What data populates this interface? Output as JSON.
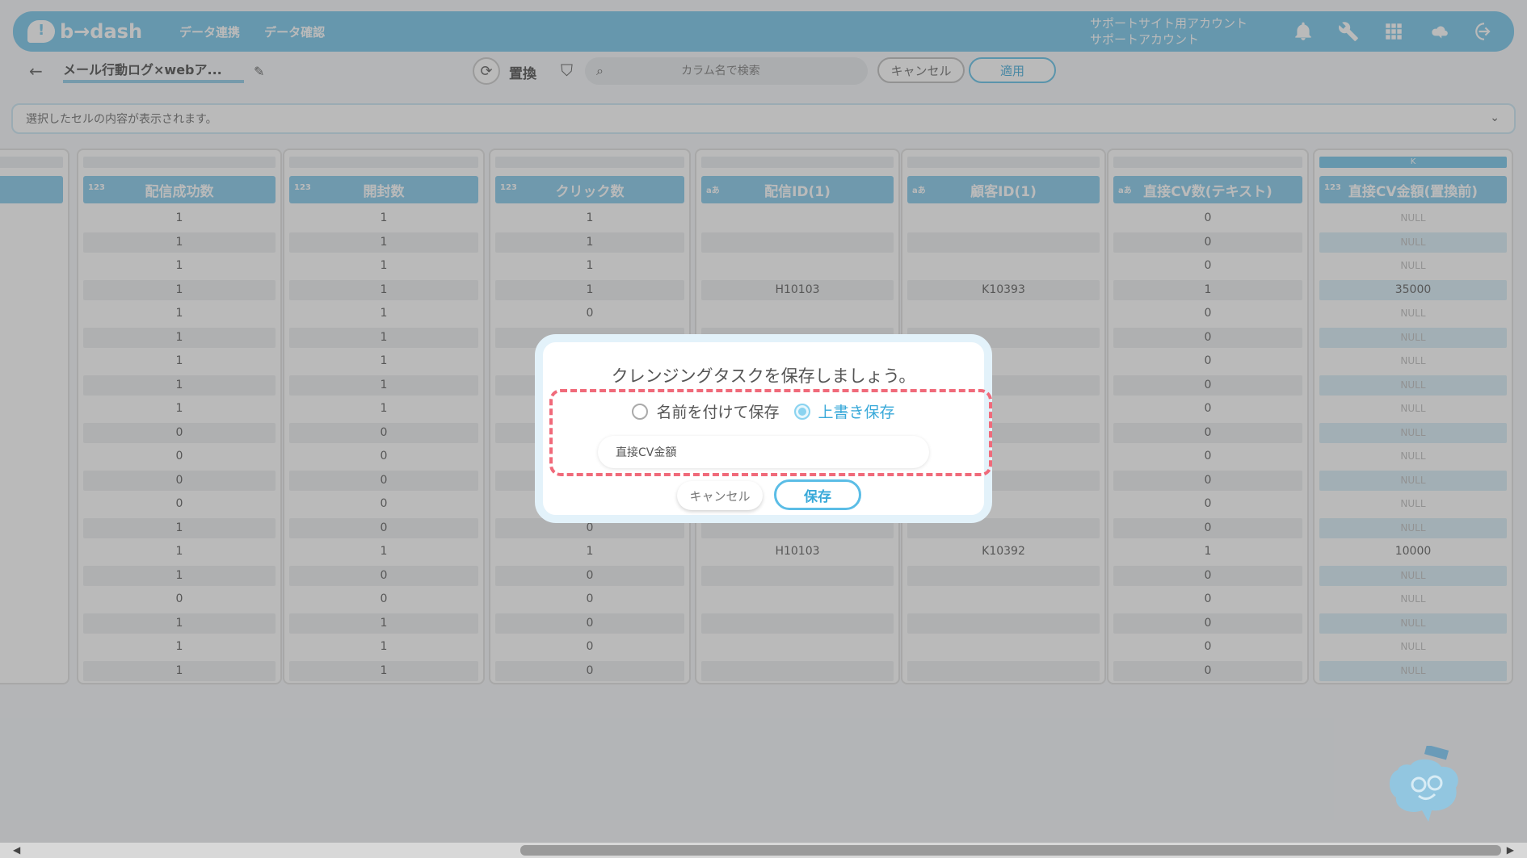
{
  "header": {
    "logo_text": "b→dash",
    "nav": [
      "データ連携",
      "データ確認"
    ],
    "account_line1": "サポートサイト用アカウント",
    "account_line2": "サポートアカウント",
    "icons": [
      "bell-icon",
      "wrench-icon",
      "grid-icon",
      "cloud-icon",
      "logout-icon"
    ]
  },
  "toolbar": {
    "title": "メール行動ログ×webア...",
    "action_label": "置換",
    "search_placeholder": "カラム名で検索",
    "cancel_label": "キャンセル",
    "apply_label": "適用"
  },
  "cell_bar": {
    "placeholder": "選択したセルの内容が表示されます。"
  },
  "columns": [
    {
      "letter": "",
      "name": "",
      "type": "",
      "cells": []
    },
    {
      "letter": "",
      "name": "配信成功数",
      "type": "123",
      "cells": [
        "1",
        "1",
        "1",
        "1",
        "1",
        "1",
        "1",
        "1",
        "1",
        "0",
        "0",
        "0",
        "0",
        "1",
        "1",
        "1",
        "0",
        "1",
        "1",
        "1"
      ]
    },
    {
      "letter": "",
      "name": "開封数",
      "type": "123",
      "cells": [
        "1",
        "1",
        "1",
        "1",
        "1",
        "1",
        "1",
        "1",
        "1",
        "0",
        "0",
        "0",
        "0",
        "0",
        "1",
        "0",
        "0",
        "1",
        "1",
        "1"
      ]
    },
    {
      "letter": "",
      "name": "クリック数",
      "type": "123",
      "cells": [
        "1",
        "1",
        "1",
        "1",
        "0",
        "",
        "",
        "",
        "",
        "",
        "",
        "",
        "",
        "0",
        "1",
        "0",
        "0",
        "0",
        "0",
        "0"
      ]
    },
    {
      "letter": "",
      "name": "配信ID(1)",
      "type": "aあ",
      "cells": [
        "",
        "",
        "",
        "H10103",
        "",
        "",
        "",
        "",
        "",
        "",
        "",
        "",
        "",
        "",
        "H10103",
        "",
        "",
        "",
        "",
        ""
      ]
    },
    {
      "letter": "",
      "name": "顧客ID(1)",
      "type": "aあ",
      "cells": [
        "",
        "",
        "",
        "K10393",
        "",
        "",
        "",
        "",
        "",
        "",
        "",
        "",
        "",
        "",
        "K10392",
        "",
        "",
        "",
        "",
        ""
      ]
    },
    {
      "letter": "",
      "name": "直接CV数(テキスト)",
      "type": "aあ",
      "cells": [
        "0",
        "0",
        "0",
        "1",
        "0",
        "0",
        "0",
        "0",
        "0",
        "0",
        "0",
        "0",
        "0",
        "0",
        "1",
        "0",
        "0",
        "0",
        "0",
        "0"
      ]
    },
    {
      "letter": "K",
      "name": "直接CV金額(置換前)",
      "type": "123",
      "cells": [
        "NULL",
        "NULL",
        "NULL",
        "35000",
        "NULL",
        "NULL",
        "NULL",
        "NULL",
        "NULL",
        "NULL",
        "NULL",
        "NULL",
        "NULL",
        "NULL",
        "10000",
        "NULL",
        "NULL",
        "NULL",
        "NULL",
        "NULL"
      ]
    }
  ],
  "dialog": {
    "title": "クレンジングタスクを保存しましょう。",
    "option_new": "名前を付けて保存",
    "option_overwrite": "上書き保存",
    "name_value": "直接CV金額",
    "cancel_label": "キャンセル",
    "save_label": "保存"
  },
  "colors": {
    "accent": "#6ec3e8",
    "highlight_dash": "#f06a7a"
  }
}
